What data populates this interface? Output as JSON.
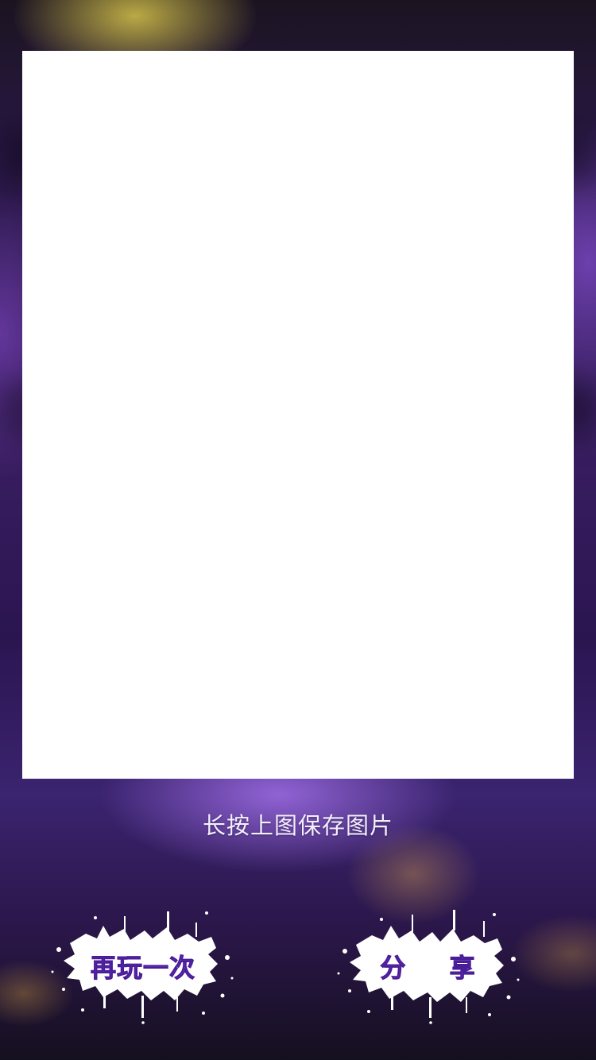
{
  "poster": {
    "background_color": "#ffffff"
  },
  "hint": {
    "text": "长按上图保存图片"
  },
  "buttons": {
    "replay_label": "再玩一次",
    "share_label": "分 享",
    "label_color": "#6b34c7",
    "splash_color": "#ffffff"
  }
}
